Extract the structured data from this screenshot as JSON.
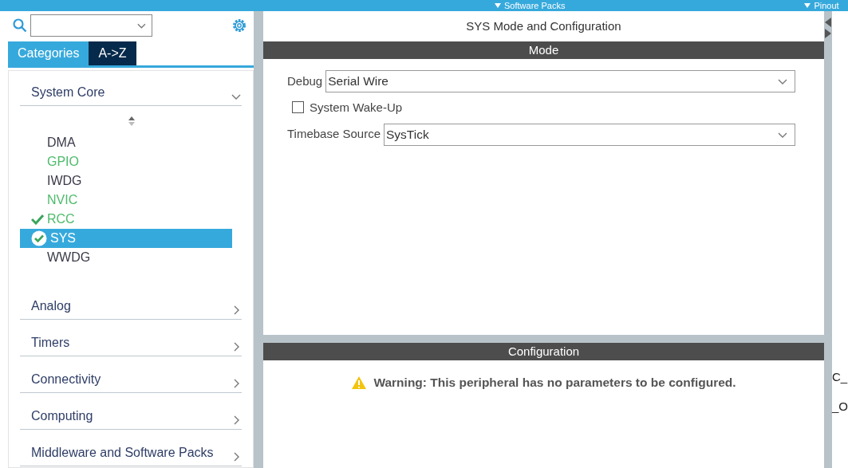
{
  "top_bar": {
    "items": [
      {
        "label": "Software Packs"
      },
      {
        "label": "Pinout"
      }
    ]
  },
  "sidebar": {
    "tabs": [
      {
        "label": "Categories",
        "selected": true
      },
      {
        "label": "A->Z",
        "selected": false
      }
    ],
    "categories": [
      {
        "label": "System Core",
        "expanded": true,
        "children": [
          {
            "label": "DMA",
            "enabled": false,
            "checked": false,
            "selected": false
          },
          {
            "label": "GPIO",
            "enabled": true,
            "checked": false,
            "selected": false
          },
          {
            "label": "IWDG",
            "enabled": false,
            "checked": false,
            "selected": false
          },
          {
            "label": "NVIC",
            "enabled": true,
            "checked": false,
            "selected": false
          },
          {
            "label": "RCC",
            "enabled": true,
            "checked": true,
            "selected": false
          },
          {
            "label": "SYS",
            "enabled": true,
            "checked": true,
            "selected": true
          },
          {
            "label": "WWDG",
            "enabled": false,
            "checked": false,
            "selected": false
          }
        ]
      },
      {
        "label": "Analog",
        "expanded": false
      },
      {
        "label": "Timers",
        "expanded": false
      },
      {
        "label": "Connectivity",
        "expanded": false
      },
      {
        "label": "Computing",
        "expanded": false
      },
      {
        "label": "Middleware and Software Packs",
        "expanded": false
      }
    ]
  },
  "main": {
    "title": "SYS Mode and Configuration",
    "mode": {
      "header": "Mode",
      "fields": [
        {
          "kind": "select",
          "label": "Debug",
          "value": "Serial Wire"
        },
        {
          "kind": "checkbox",
          "label": "System Wake-Up",
          "checked": false
        },
        {
          "kind": "select",
          "label": "Timebase Source",
          "value": "SysTick"
        }
      ]
    },
    "configuration": {
      "header": "Configuration",
      "warning": "Warning: This peripheral has no parameters to be configured."
    }
  },
  "right_edge": {
    "texts": [
      "C_",
      "_O"
    ]
  }
}
